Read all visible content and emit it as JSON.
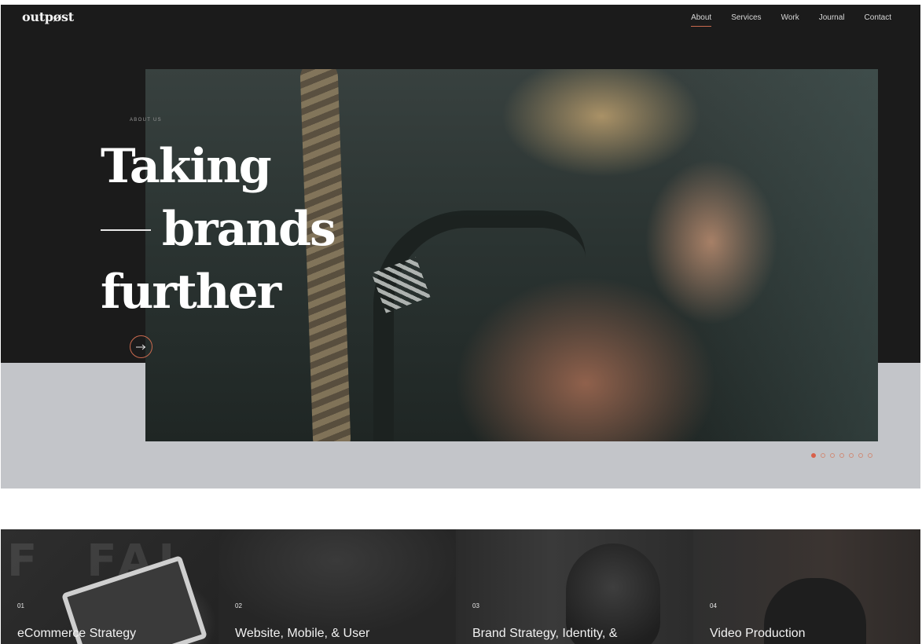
{
  "brand": {
    "logo": "outpøst"
  },
  "nav": {
    "items": [
      {
        "label": "About",
        "active": true
      },
      {
        "label": "Services",
        "active": false
      },
      {
        "label": "Work",
        "active": false
      },
      {
        "label": "Journal",
        "active": false
      },
      {
        "label": "Contact",
        "active": false
      }
    ]
  },
  "hero": {
    "kicker": "ABOUT US",
    "headline_line1": "Taking",
    "headline_line2": "brands",
    "headline_line3": "further",
    "arrow_icon": "arrow-right-icon",
    "slider": {
      "count": 7,
      "active_index": 0
    }
  },
  "colors": {
    "accent": "#c9694e",
    "dark": "#1b1b1b",
    "band": "#c3c5c9"
  },
  "services": [
    {
      "num": "01",
      "title": "eCommerce Strategy"
    },
    {
      "num": "02",
      "title": "Website, Mobile, & User"
    },
    {
      "num": "03",
      "title": "Brand Strategy, Identity, &"
    },
    {
      "num": "04",
      "title": "Video Production"
    }
  ]
}
